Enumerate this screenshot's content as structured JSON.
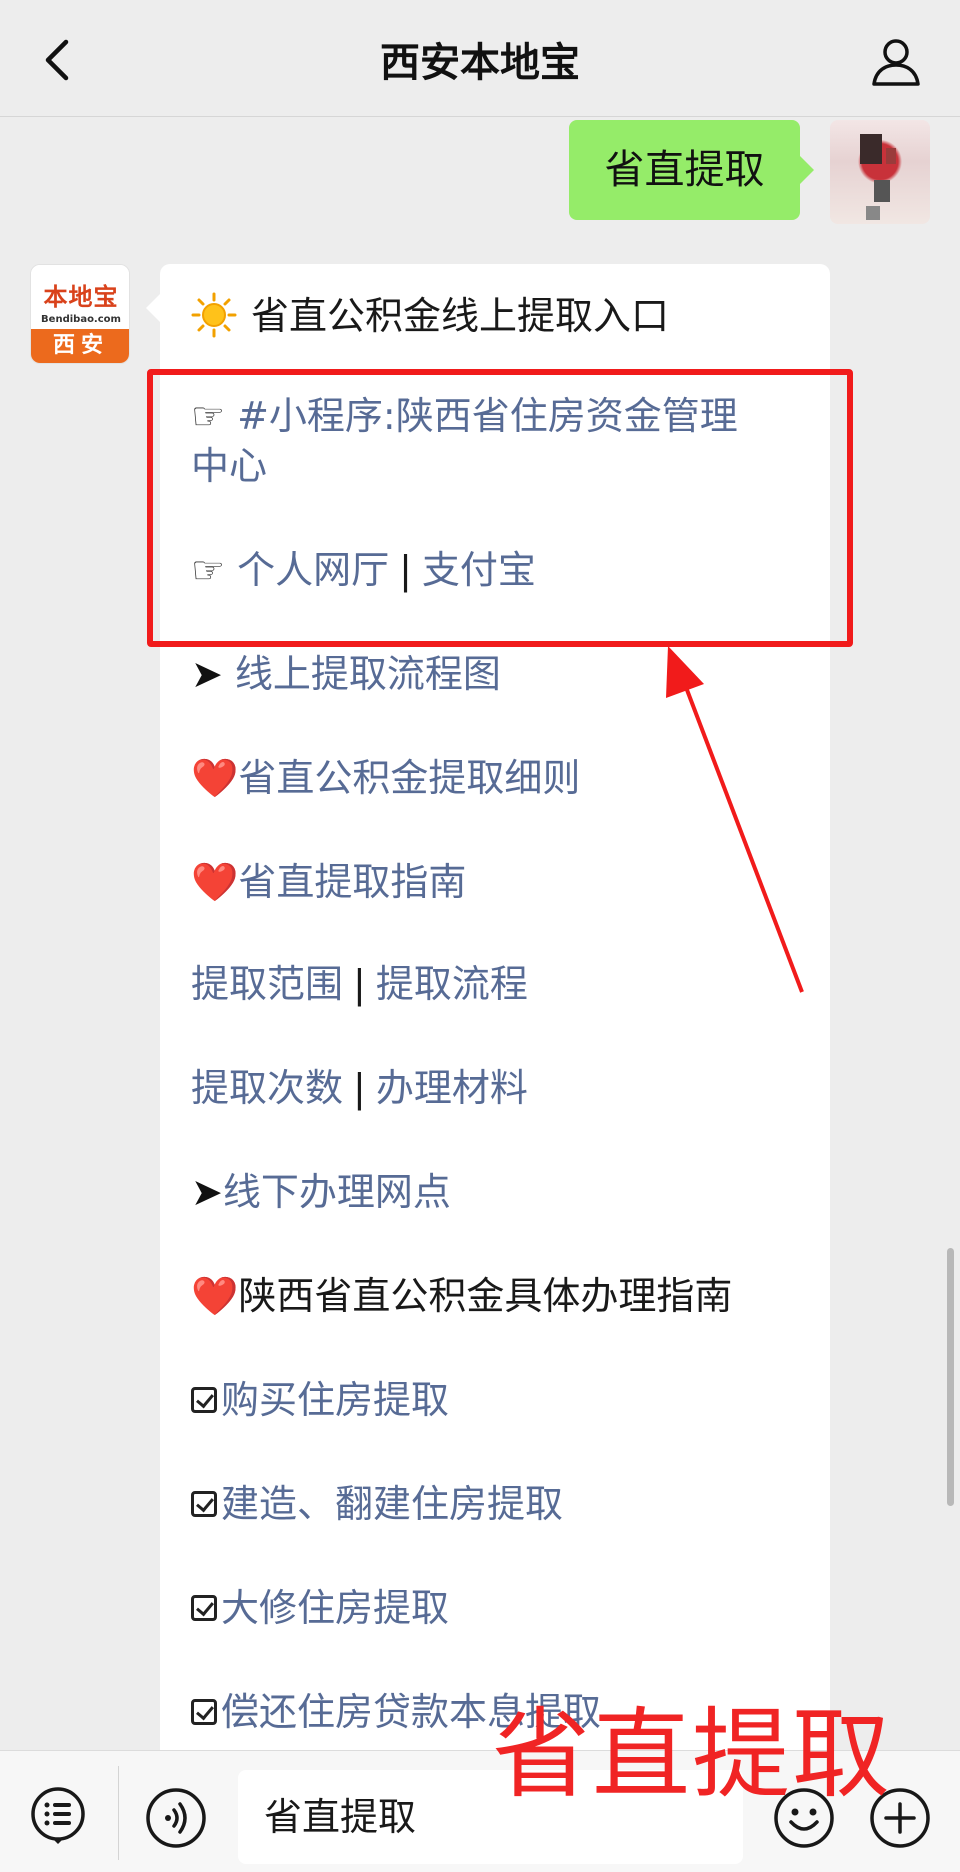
{
  "header": {
    "title": "西安本地宝"
  },
  "chat": {
    "outgoing": {
      "text": "省直提取"
    },
    "bot_logo": {
      "name": "本地宝",
      "url": "Bendibao.com",
      "city": "西安"
    },
    "incoming": {
      "heading": "省直公积金线上提取入口",
      "pointer_glyph": "☞",
      "arrow_glyph": "➤",
      "heart_glyph": "❤️",
      "line1": "#小程序:陕西省住房资金管理",
      "line1b": "中心",
      "line2a": "个人网厅",
      "line2sep": "|",
      "line2b": "支付宝",
      "line3": "线上提取流程图",
      "line4": "省直公积金提取细则",
      "line5": "省直提取指南",
      "line6a": "提取范围",
      "line6sep": "|",
      "line6b": "提取流程",
      "line7a": "提取次数",
      "line7sep": "|",
      "line7b": "办理材料",
      "line8": "线下办理网点",
      "line9": "陕西省直公积金具体办理指南",
      "line10": "购买住房提取",
      "line11": "建造、翻建住房提取",
      "line12": "大修住房提取",
      "line13": "偿还住房贷款本息提取"
    }
  },
  "overlay": {
    "caption": "省直提取",
    "highlight_color": "#f11b1b"
  },
  "input_bar": {
    "value": "省直提取"
  },
  "colors": {
    "link": "#576b95",
    "outgoing_bubble": "#95ec69",
    "background": "#ededed"
  }
}
